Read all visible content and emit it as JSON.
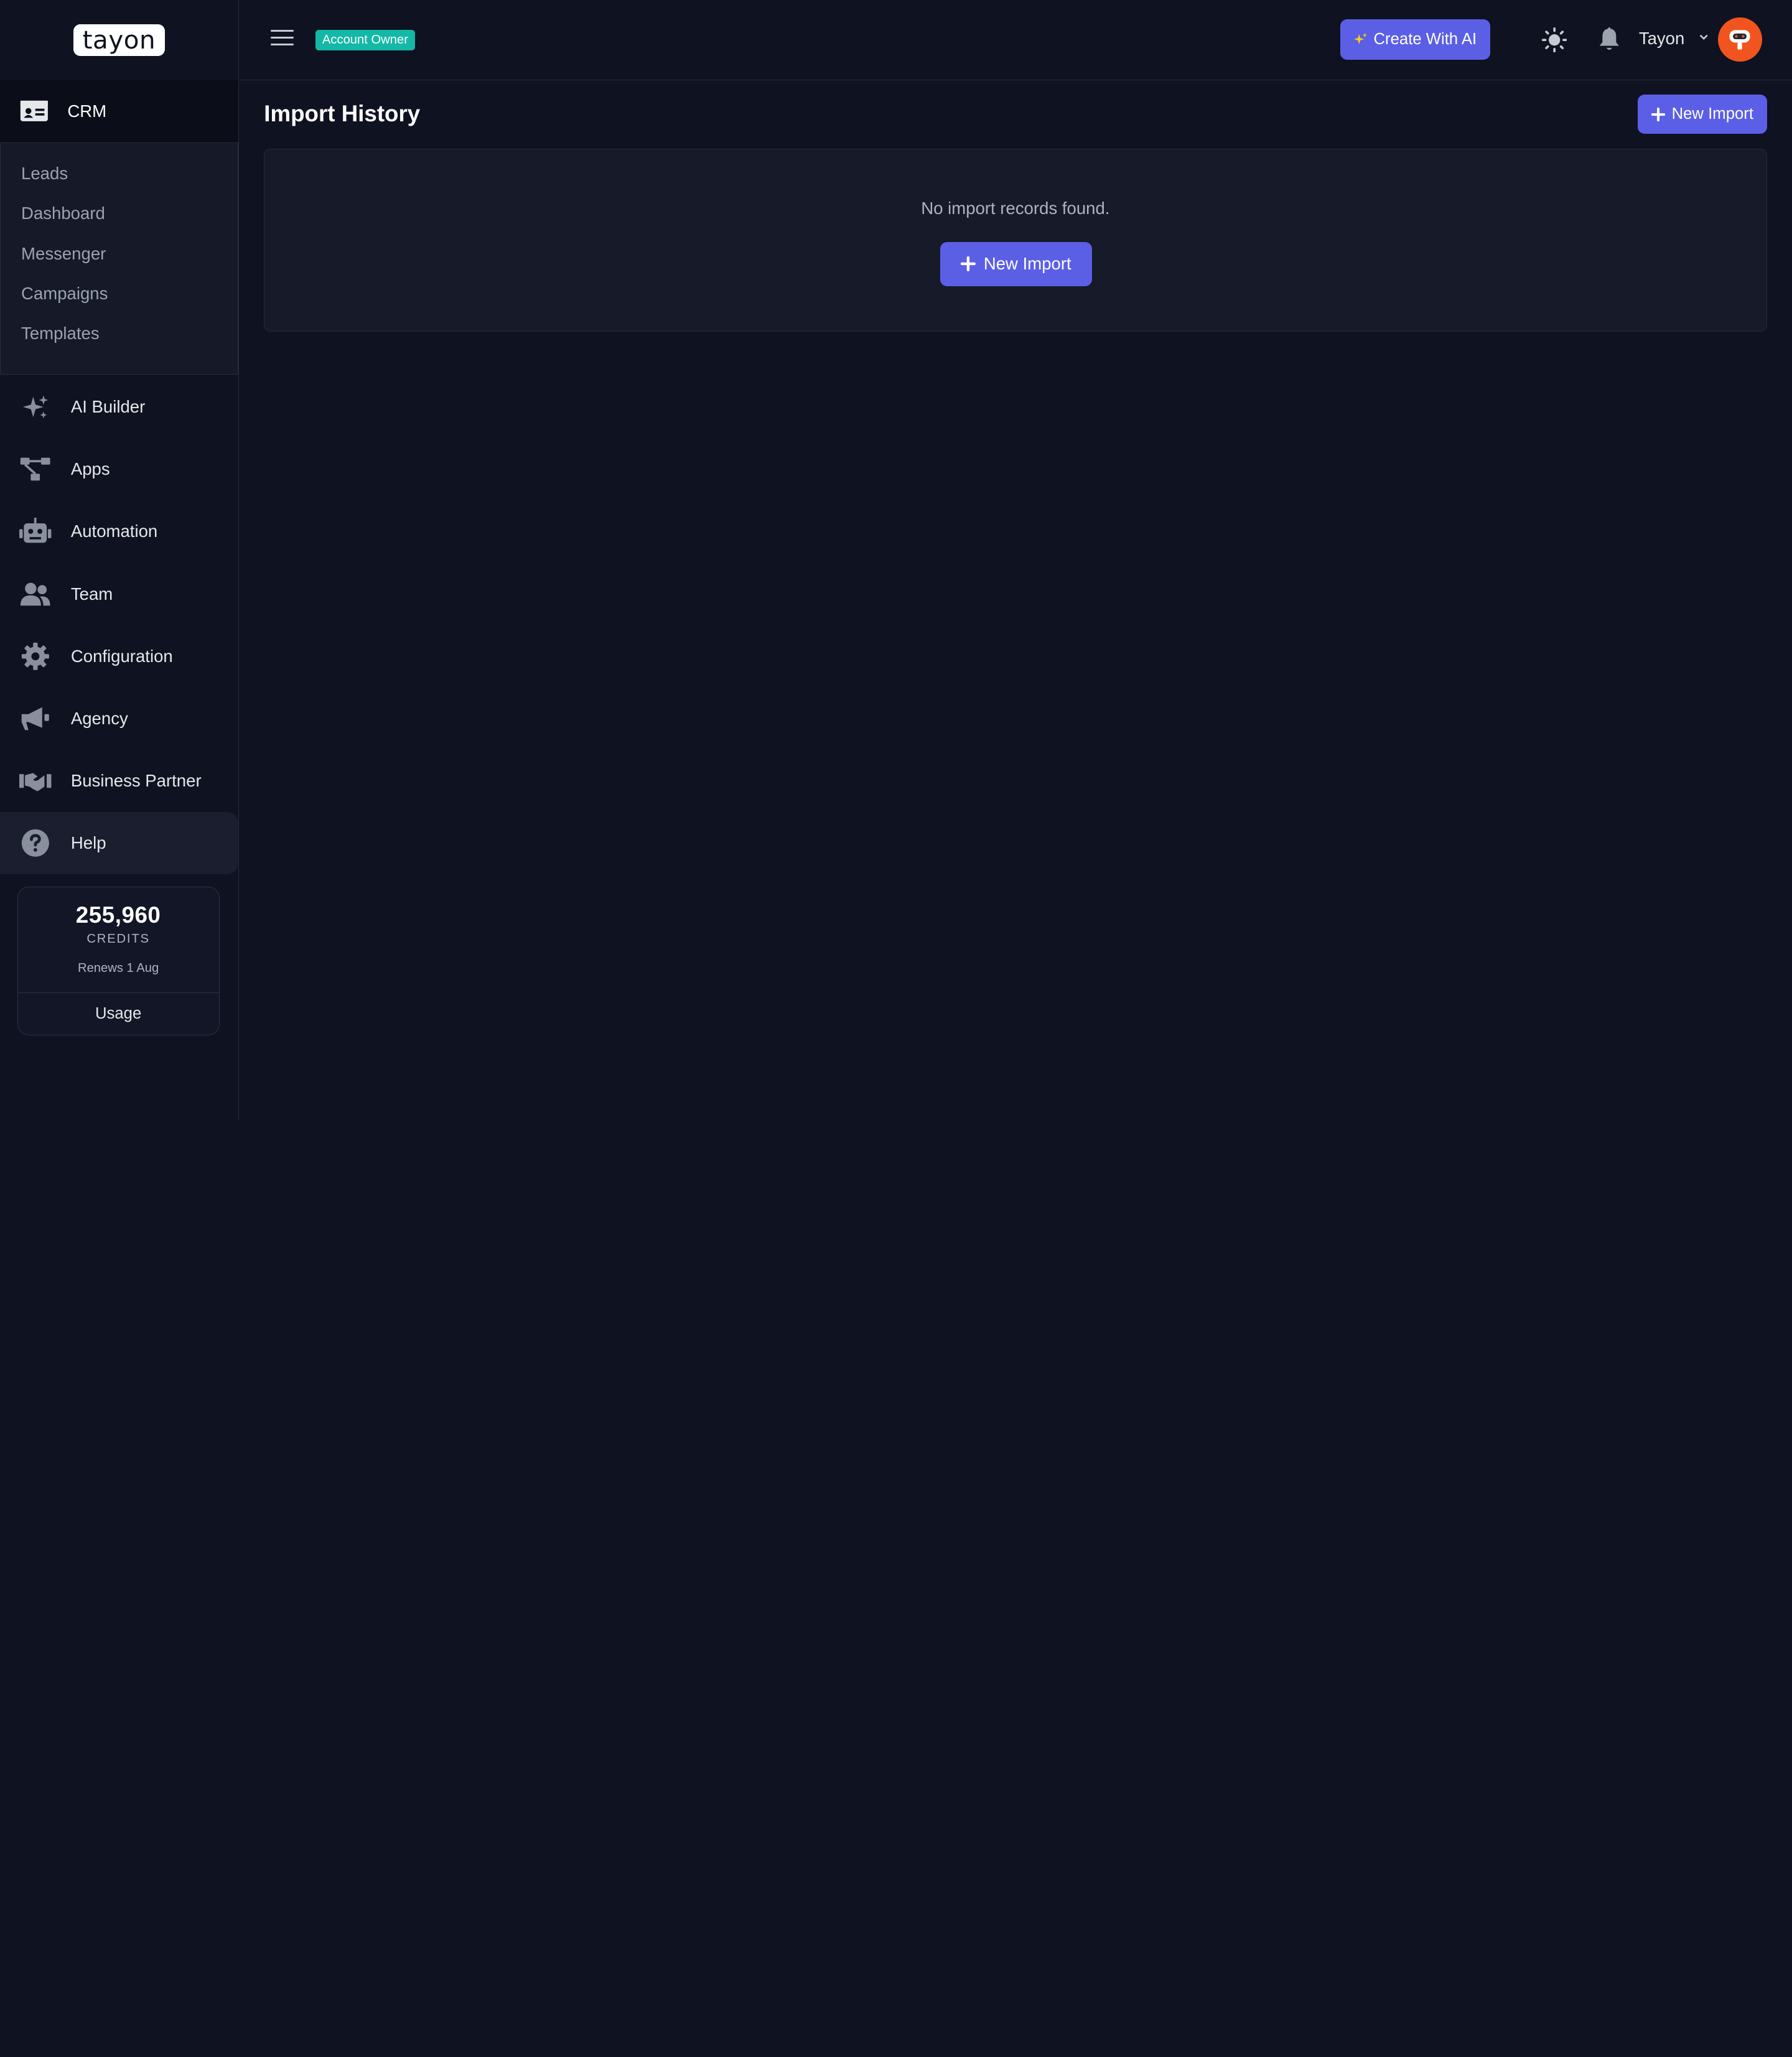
{
  "brand": {
    "logo_text": "tayon"
  },
  "sidebar": {
    "crm": {
      "label": "CRM",
      "icon": "id-card-icon",
      "items": [
        {
          "label": "Leads"
        },
        {
          "label": "Dashboard"
        },
        {
          "label": "Messenger"
        },
        {
          "label": "Campaigns"
        },
        {
          "label": "Templates"
        }
      ]
    },
    "items": [
      {
        "label": "AI Builder",
        "icon": "sparkles-icon"
      },
      {
        "label": "Apps",
        "icon": "sitemap-icon"
      },
      {
        "label": "Automation",
        "icon": "robot-icon"
      },
      {
        "label": "Team",
        "icon": "users-icon"
      },
      {
        "label": "Configuration",
        "icon": "gear-icon"
      },
      {
        "label": "Agency",
        "icon": "megaphone-icon"
      },
      {
        "label": "Business Partner",
        "icon": "handshake-icon"
      },
      {
        "label": "Help",
        "icon": "question-circle-icon",
        "active": true
      }
    ],
    "credits": {
      "amount": "255,960",
      "unit": "CREDITS",
      "renews": "Renews 1 Aug",
      "usage_label": "Usage"
    }
  },
  "topbar": {
    "role_badge": "Account Owner",
    "create_ai_label": "Create With AI",
    "user_name": "Tayon"
  },
  "main": {
    "title": "Import History",
    "new_import_label": "New Import",
    "empty_message": "No import records found.",
    "empty_new_import_label": "New Import"
  },
  "colors": {
    "background": "#0f1220",
    "accent": "#5b5fe6",
    "badge": "#14b8a6",
    "avatar": "#f1541e"
  }
}
